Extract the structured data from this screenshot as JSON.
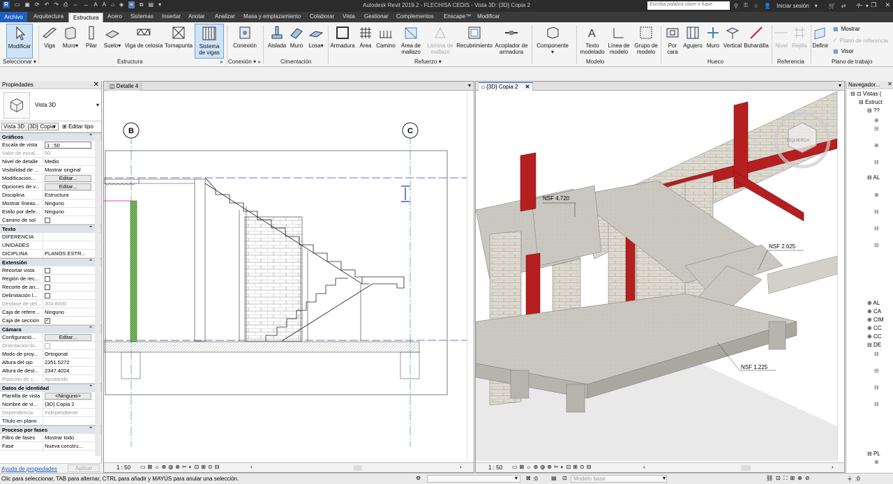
{
  "app": {
    "title": "Autodesk Revit 2019.2 - FLECHISA CEDIS - Vista 3D: {3D} Copia 2",
    "search_placeholder": "Escriba palabra clave o frase",
    "signin": "Iniciar sesión"
  },
  "tabs": [
    "Archivo",
    "Arquitectura",
    "Estructura",
    "Acero",
    "Sistemas",
    "Insertar",
    "Anotar",
    "Analizar",
    "Masa y emplazamiento",
    "Colaborar",
    "Vista",
    "Gestionar",
    "Complementos",
    "Enscape™",
    "Modificar"
  ],
  "ribbon": {
    "modify": "Modificar",
    "select_panel": "Seleccionar",
    "estructura": {
      "panel": "Estructura",
      "buttons": [
        "Viga",
        "Muro",
        "Pilar",
        "Suelo",
        "Viga de celosía",
        "Tornapunta",
        "Sistema de vigas"
      ]
    },
    "conexion": {
      "panel": "Conexión",
      "buttons": [
        "Conexión"
      ]
    },
    "cimentacion": {
      "panel": "Cimentación",
      "buttons": [
        "Aislada",
        "Muro",
        "Losa"
      ]
    },
    "refuerzo": {
      "panel": "Refuerzo",
      "buttons": [
        "Armadura",
        "Área",
        "Camino",
        "Área de mallazo",
        "Lámina de mallazo",
        "Recubrimiento",
        "Acoplador de armadura"
      ]
    },
    "componente": {
      "buttons": [
        "Componente"
      ]
    },
    "modelo": {
      "panel": "Modelo",
      "buttons": [
        "Texto modelado",
        "Línea de modelo",
        "Grupo de modelo"
      ]
    },
    "hueco": {
      "panel": "Hueco",
      "buttons": [
        "Por cara",
        "Agujero",
        "Muro",
        "Vertical",
        "Buhardilla"
      ]
    },
    "referencia": {
      "panel": "Referencia",
      "buttons": [
        "Nivel",
        "Rejilla"
      ]
    },
    "plano": {
      "panel": "Plano de trabajo",
      "buttons": [
        "Definir",
        "Mostrar",
        "Plano de referencia",
        "Visor"
      ]
    }
  },
  "properties": {
    "title": "Propiedades",
    "type_name": "Vista 3D",
    "filter": "Vista 3D: {3D} Copia",
    "edit_type": "Editar tipo",
    "sections": [
      {
        "name": "Gráficos",
        "rows": [
          {
            "n": "Escala de vista",
            "v": "1 : 50",
            "k": "input"
          },
          {
            "n": "Valor de escal...",
            "v": "50",
            "k": "gray"
          },
          {
            "n": "Nivel de detalle",
            "v": "Medio"
          },
          {
            "n": "Visibilidad de ...",
            "v": "Mostrar original"
          },
          {
            "n": "Modificacion...",
            "v": "Editar...",
            "k": "btn"
          },
          {
            "n": "Opciones de v...",
            "v": "Editar...",
            "k": "btn"
          },
          {
            "n": "Disciplina",
            "v": "Estructura"
          },
          {
            "n": "Mostrar líneas...",
            "v": "Ninguno"
          },
          {
            "n": "Estilo por defe...",
            "v": "Ninguno"
          },
          {
            "n": "Camino de sol",
            "v": "",
            "k": "chk"
          }
        ]
      },
      {
        "name": "Texto",
        "rows": [
          {
            "n": "DIFERENCIA",
            "v": ""
          },
          {
            "n": "UNIDADES",
            "v": ""
          },
          {
            "n": "DICIPLINA",
            "v": "PLANOS ESTR..."
          }
        ]
      },
      {
        "name": "Extensión",
        "rows": [
          {
            "n": "Recortar vista",
            "v": "",
            "k": "chk"
          },
          {
            "n": "Región de rec...",
            "v": "",
            "k": "chk"
          },
          {
            "n": "Recorte de an...",
            "v": "",
            "k": "chk"
          },
          {
            "n": "Delimitación l...",
            "v": "",
            "k": "chk"
          },
          {
            "n": "Desfase de del...",
            "v": "304.8000",
            "k": "gray"
          },
          {
            "n": "Caja de refere...",
            "v": "Ninguno"
          },
          {
            "n": "Caja de sección",
            "v": "✓",
            "k": "chk"
          }
        ]
      },
      {
        "name": "Cámara",
        "rows": [
          {
            "n": "Configuració...",
            "v": "Editar...",
            "k": "btn"
          },
          {
            "n": "Orientación bl...",
            "v": "",
            "k": "graychk"
          },
          {
            "n": "Modo de proy...",
            "v": "Ortogonal"
          },
          {
            "n": "Altura del ojo",
            "v": "2351.5272"
          },
          {
            "n": "Altura de dest...",
            "v": "2347.4024"
          },
          {
            "n": "Posición de c...",
            "v": "Ajustando",
            "k": "gray"
          }
        ]
      },
      {
        "name": "Datos de identidad",
        "rows": [
          {
            "n": "Plantilla de vista",
            "v": "<Ninguno>",
            "k": "btn"
          },
          {
            "n": "Nombre de vi...",
            "v": "{3D} Copia 2"
          },
          {
            "n": "Dependencia",
            "v": "Independiente",
            "k": "gray"
          },
          {
            "n": "Título en plano",
            "v": ""
          }
        ]
      },
      {
        "name": "Proceso por fases",
        "rows": [
          {
            "n": "Filtro de fases",
            "v": "Mostrar todo"
          },
          {
            "n": "Fase",
            "v": "Nueva constru..."
          }
        ]
      }
    ],
    "help_link": "Ayuda de propiedades",
    "apply": "Aplicar"
  },
  "views": {
    "left": {
      "tab": "Detalle 4",
      "scale": "1 : 50",
      "grid_b": "B",
      "grid_c": "C"
    },
    "right": {
      "tab": "{3D} Copia 2",
      "scale": "1 : 50",
      "levels": [
        "NSF 4.720",
        "NSF 2.625",
        "NSF 1.225"
      ],
      "cube_label": "IZQUIERDA"
    }
  },
  "navigator": {
    "title": "Navegador...",
    "items": [
      "Vistas (",
      "Estruct",
      "??",
      "AL",
      "AL",
      "CA",
      "CIM",
      "CC",
      "CC",
      "DE",
      "PL"
    ]
  },
  "status": {
    "message": "Clic para seleccionar, TAB para alternar, CTRL para añadir y MAYÚS para anular una selección.",
    "zero": ":0",
    "model": "Modelo base",
    "filter_zero": ":0"
  },
  "colors": {
    "accent": "#1f5fbf",
    "steel": "#b51f1f",
    "active_tab": "#f3f3f3"
  }
}
